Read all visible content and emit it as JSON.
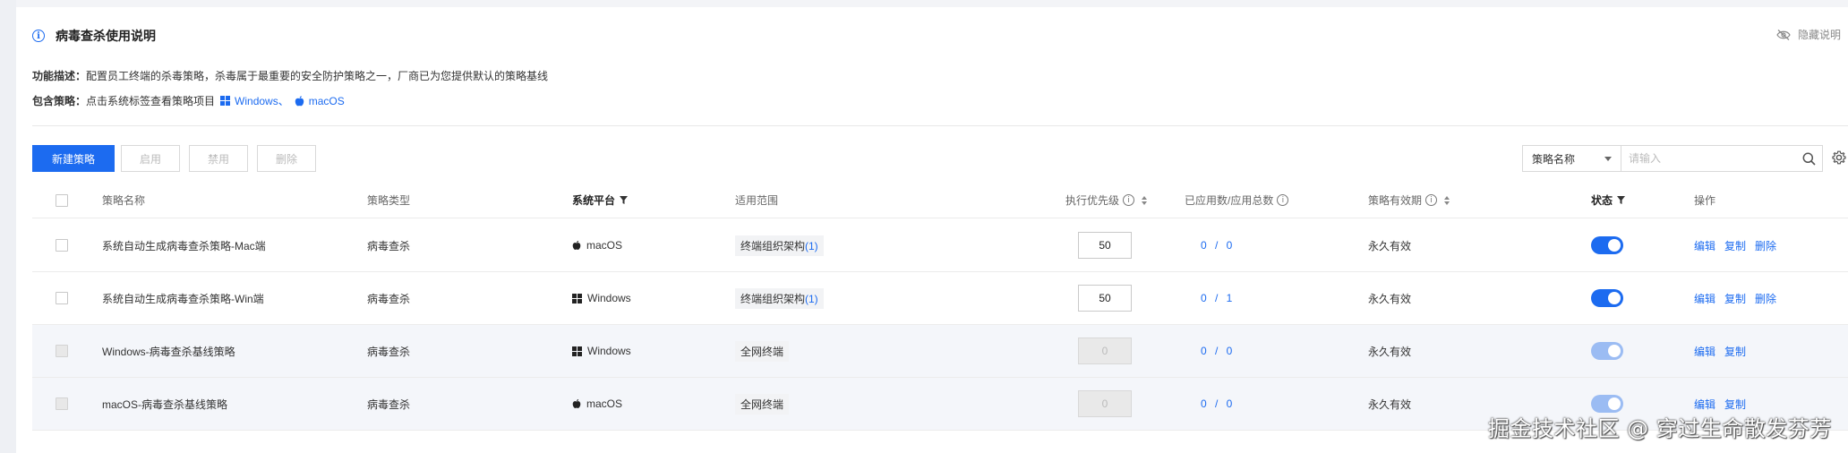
{
  "header": {
    "title": "病毒查杀使用说明",
    "hide_label": "隐藏说明",
    "desc_label": "功能描述：",
    "desc_text": "配置员工终端的杀毒策略，杀毒属于最重要的安全防护策略之一，厂商已为您提供默认的策略基线",
    "include_label": "包含策略：",
    "include_text": "点击系统标签查看策略项目",
    "os_windows": "Windows、",
    "os_macos": "macOS"
  },
  "toolbar": {
    "new_label": "新建策略",
    "enable_label": "启用",
    "disable_label": "禁用",
    "delete_label": "删除",
    "search_field": "策略名称",
    "search_placeholder": "请输入"
  },
  "table": {
    "columns": {
      "name": "策略名称",
      "type": "策略类型",
      "platform": "系统平台",
      "scope": "适用范围",
      "priority": "执行优先级",
      "applied": "已应用数/应用总数",
      "validity": "策略有效期",
      "status": "状态",
      "ops": "操作"
    },
    "rows": [
      {
        "name": "系统自动生成病毒查杀策略-Mac端",
        "type": "病毒查杀",
        "platform": "macOS",
        "scope": "终端组织架构",
        "scope_count": "(1)",
        "priority": "50",
        "applied": "0 / 0",
        "validity": "永久有效",
        "edit": "编辑",
        "copy": "复制",
        "delete": "删除"
      },
      {
        "name": "系统自动生成病毒查杀策略-Win端",
        "type": "病毒查杀",
        "platform": "Windows",
        "scope": "终端组织架构",
        "scope_count": "(1)",
        "priority": "50",
        "applied": "0 / 1",
        "validity": "永久有效",
        "edit": "编辑",
        "copy": "复制",
        "delete": "删除"
      },
      {
        "name": "Windows-病毒查杀基线策略",
        "type": "病毒查杀",
        "platform": "Windows",
        "scope": "全网终端",
        "priority": "0",
        "applied": "0 / 0",
        "validity": "永久有效",
        "edit": "编辑",
        "copy": "复制"
      },
      {
        "name": "macOS-病毒查杀基线策略",
        "type": "病毒查杀",
        "platform": "macOS",
        "scope": "全网终端",
        "priority": "0",
        "applied": "0 / 0",
        "validity": "永久有效",
        "edit": "编辑",
        "copy": "复制"
      }
    ]
  },
  "watermark": "掘金技术社区 @ 穿过生命散发芬芳",
  "colors": {
    "accent": "#1c6bf0",
    "disabled_row": "#f4f6fa"
  }
}
